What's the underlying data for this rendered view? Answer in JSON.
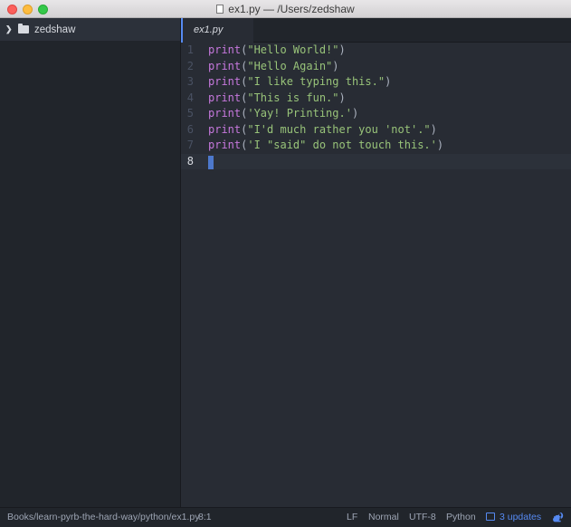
{
  "window": {
    "title": "ex1.py — /Users/zedshaw"
  },
  "tree": {
    "root_label": "zedshaw"
  },
  "tabs": [
    {
      "label": "ex1.py"
    }
  ],
  "editor": {
    "lines": [
      {
        "num": "1",
        "fn": "print",
        "open": "(",
        "str": "\"Hello World!\"",
        "close": ")"
      },
      {
        "num": "2",
        "fn": "print",
        "open": "(",
        "str": "\"Hello Again\"",
        "close": ")"
      },
      {
        "num": "3",
        "fn": "print",
        "open": "(",
        "str": "\"I like typing this.\"",
        "close": ")"
      },
      {
        "num": "4",
        "fn": "print",
        "open": "(",
        "str": "\"This is fun.\"",
        "close": ")"
      },
      {
        "num": "5",
        "fn": "print",
        "open": "(",
        "str": "'Yay! Printing.'",
        "close": ")"
      },
      {
        "num": "6",
        "fn": "print",
        "open": "(",
        "str": "\"I'd much rather you 'not'.\"",
        "close": ")"
      },
      {
        "num": "7",
        "fn": "print",
        "open": "(",
        "str": "'I \"said\" do not touch this.'",
        "close": ")"
      },
      {
        "num": "8",
        "fn": "",
        "open": "",
        "str": "",
        "close": ""
      }
    ]
  },
  "status": {
    "file_path": "Books/learn-pyrb-the-hard-way/python/ex1.py",
    "cursor_pos": "8:1",
    "line_ending": "LF",
    "mode": "Normal",
    "encoding": "UTF-8",
    "grammar": "Python",
    "updates": "3 updates"
  },
  "colors": {
    "accent": "#568af2",
    "keyword": "#c678dd",
    "string": "#98c379",
    "editor_bg": "#282c34",
    "panel_bg": "#21252b"
  },
  "icons": {
    "close": "close-button",
    "minimize": "minimize-button",
    "maximize": "maximize-button",
    "folder": "folder-icon",
    "package": "package-icon",
    "squirrel": "squirrel-icon"
  }
}
